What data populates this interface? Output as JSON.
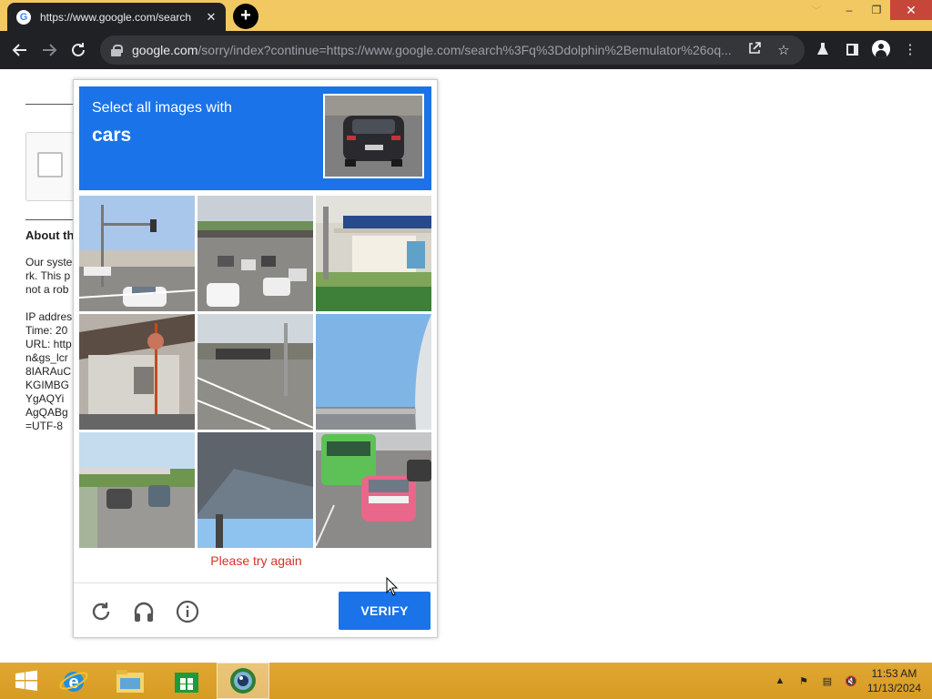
{
  "browser": {
    "tab_title": "https://www.google.com/search",
    "tab_close": "✕",
    "new_tab": "+",
    "url_host": "google.com",
    "url_path": "/sorry/index?continue=https://www.google.com/search%3Fq%3Ddolphin%2Bemulator%26oq...",
    "window_controls": {
      "minimize": "–",
      "restore": "❐",
      "close": "✕"
    }
  },
  "page": {
    "heading": "About th",
    "para_lines": "Our syste\nrk. This p\nnot a rob",
    "info_lines": "IP addres\nTime: 20\nURL: http\nn&gs_lcr\n8IARAuC\nKGIMBG\nYgAQYi\nAgQABg\n=UTF-8"
  },
  "captcha": {
    "instruction_line1": "Select all images with",
    "instruction_target": "cars",
    "error_message": "Please try again",
    "verify_label": "VERIFY",
    "footer_icons": [
      "reload-icon",
      "audio-icon",
      "info-icon"
    ],
    "tiles": [
      "street corner with traffic light and white car",
      "highway with traffic under overpass",
      "building storefront with plants",
      "house with red pole",
      "street with motorcycles",
      "sky with overpass",
      "road with overpass and cars",
      "underside of bridge",
      "green bus and pink car"
    ]
  },
  "taskbar": {
    "apps": [
      "ie-icon",
      "file-explorer-icon",
      "store-icon",
      "chrome-icon"
    ],
    "time": "11:53 AM",
    "date": "11/13/2024"
  },
  "colors": {
    "accent": "#1a73e8",
    "error": "#d93025",
    "titlebar": "#f1c862",
    "toolbar": "#202124"
  }
}
